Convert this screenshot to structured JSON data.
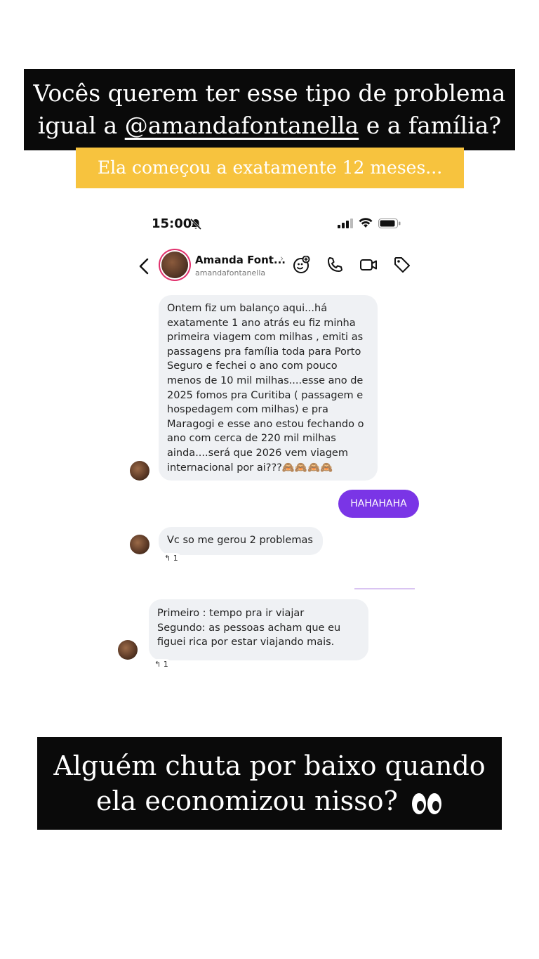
{
  "overlay": {
    "headline_part1": "Vocês querem ter esse tipo de problema igual a ",
    "headline_mention": "@amandafontanella",
    "headline_part2": " e a família?",
    "subline": "Ela começou a exatamente 12 meses...",
    "footer_line1": "Alguém chuta por baixo quando",
    "footer_line2": "ela economizou nisso?",
    "footer_emoji": "eyes-emoji"
  },
  "status_bar": {
    "time": "15:00",
    "icons": [
      "bell-muted-icon",
      "signal-icon",
      "wifi-icon",
      "battery-icon"
    ]
  },
  "chat_header": {
    "name": "Amanda Font...",
    "username": "amandafontanella",
    "icons": [
      "back-icon",
      "avatar",
      "sticker-add-icon",
      "phone-icon",
      "video-icon",
      "tag-icon"
    ]
  },
  "messages": [
    {
      "from": "contact",
      "text": "Ontem fiz um balanço aqui...há exatamente 1 ano atrás eu fiz minha primeira viagem com milhas , emiti as passagens pra família toda  para Porto Seguro e fechei o ano com pouco menos de 10 mil milhas....esse ano de 2025 fomos pra Curitiba ( passagem e hospedagem com milhas) e pra Maragogi e esse ano estou fechando o ano com cerca de 220 mil milhas ainda....será que 2026 vem viagem internacional por ai???🙈🙈🙈🙈"
    },
    {
      "from": "me",
      "text": "HAHAHAHA"
    },
    {
      "from": "contact",
      "text": "Vc so me gerou 2 problemas",
      "reply_count": "1"
    },
    {
      "from": "contact",
      "text": "Primeiro : tempo pra ir viajar\nSegundo: as pessoas acham que eu figuei rica por estar viajando mais.",
      "reply_count": "1"
    }
  ],
  "colors": {
    "headline_bg": "#0a0a0a",
    "subline_bg": "#f7c33e",
    "outgoing_bubble": "#7a35e6",
    "incoming_bubble": "#eff1f4"
  }
}
